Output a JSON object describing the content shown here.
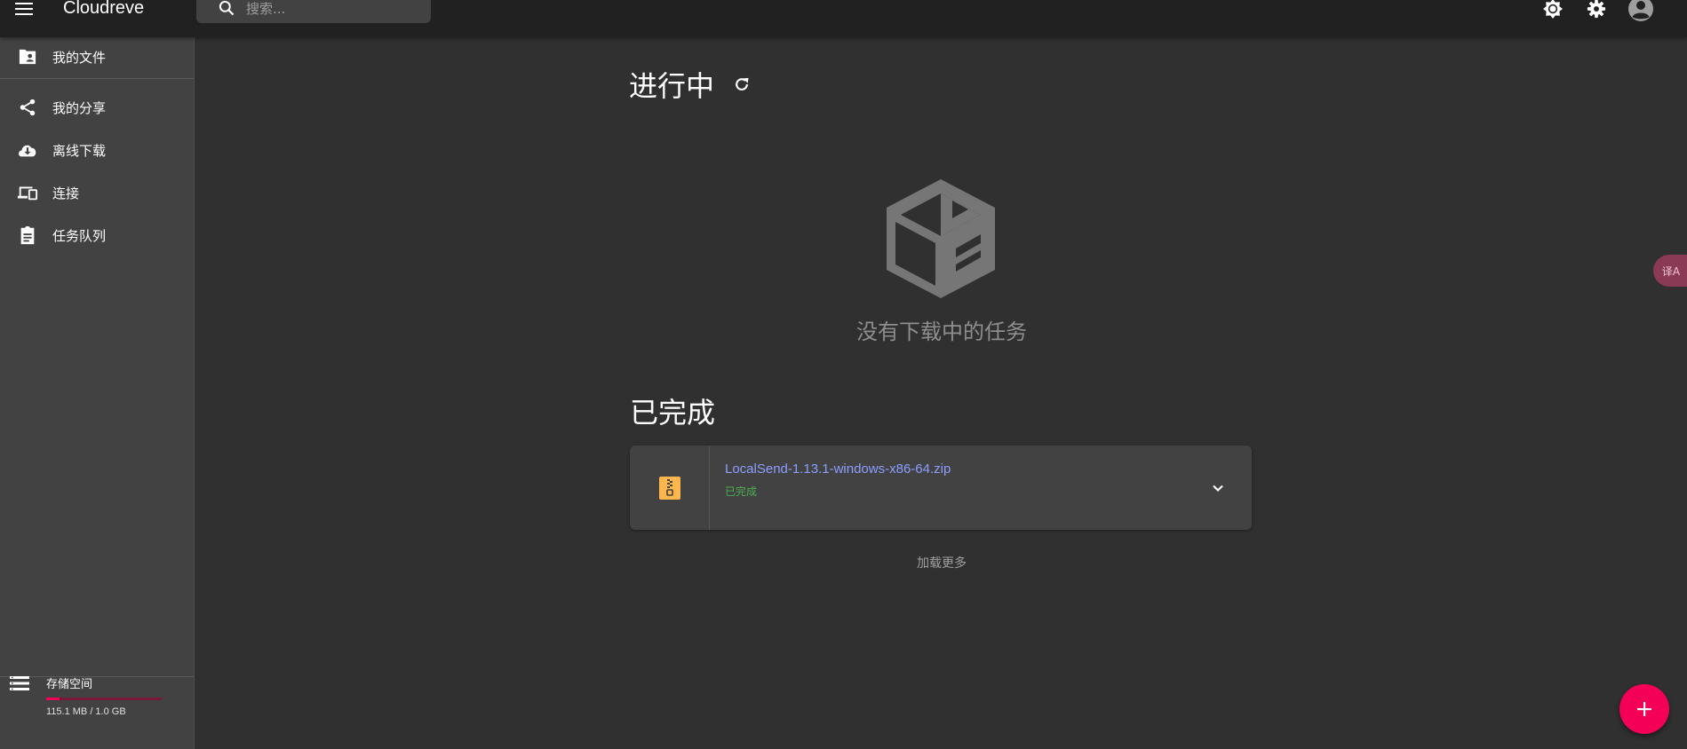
{
  "app": {
    "title": "Cloudreve"
  },
  "search": {
    "placeholder": "搜索..."
  },
  "sidebar": {
    "items": [
      {
        "label": "我的文件",
        "icon": "folder-shared-icon"
      },
      {
        "label": "我的分享",
        "icon": "share-icon"
      },
      {
        "label": "离线下载",
        "icon": "cloud-download-icon"
      },
      {
        "label": "连接",
        "icon": "devices-icon"
      },
      {
        "label": "任务队列",
        "icon": "clipboard-task-icon"
      }
    ],
    "storage": {
      "title": "存储空间",
      "usage_text": "115.1 MB / 1.0 GB",
      "used_fraction": 0.112
    }
  },
  "main": {
    "in_progress": {
      "title": "进行中",
      "empty_text": "没有下载中的任务"
    },
    "completed": {
      "title": "已完成",
      "tasks": [
        {
          "file_name": "LocalSend-1.13.1-windows-x86-64.zip",
          "status": "已完成",
          "icon": "zip-file-icon"
        }
      ],
      "load_more": "加载更多"
    }
  },
  "floating": {
    "translate_label": "译A"
  },
  "colors": {
    "accent": "#f50057",
    "link": "#8c9eff",
    "success": "#4caf50",
    "appbar": "#212121",
    "sidebar": "#424242",
    "background": "#303030",
    "zip_icon": "#ffb74d"
  }
}
